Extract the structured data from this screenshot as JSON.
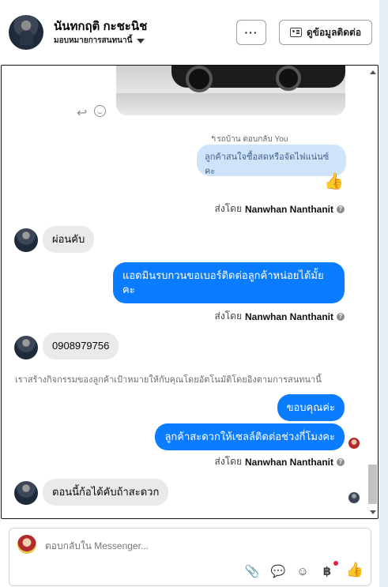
{
  "header": {
    "contact_name": "นันทกฤติ กะชะนิช",
    "assign_label": "มอบหมายการสนทนานี้",
    "more_label": "···",
    "contact_info_label": "ดูข้อมูลติดต่อ"
  },
  "thread": {
    "reply_label": "↰รถบ้าน ตอบกลับ You",
    "quoted_message": "ลูกค้าสนใจซื้อสดหรือจัดไฟแน่นซ์คะ",
    "sent_by_prefix": "ส่งโดย",
    "sender_name": "Nanwhan Nanthanit",
    "help_glyph": "?",
    "messages": [
      {
        "direction": "in",
        "text": "ผ่อนคับ"
      },
      {
        "direction": "out",
        "text_line1": "แอดมินรบกวนขอเบอร์ติดต่อลูกค้าหน่อยได้มั้ย",
        "text_line2": "คะ"
      },
      {
        "direction": "in",
        "text": "0908979756"
      },
      {
        "direction": "out",
        "text": "ขอบคุณค่ะ"
      },
      {
        "direction": "out",
        "text": "ลูกค้าสะดวกให้เซลล์ติดต่อช่วงกี่โมงคะ"
      },
      {
        "direction": "in",
        "text": "ตอนนี้ก้อได้คับถ้าสะดวก"
      }
    ],
    "info_line": "เราสร้างกิจกรรมของลูกค้าเป้าหมายให้กับคุณโดยอัตโนมัติโดยอิงตามการสนทนานี้"
  },
  "composer": {
    "placeholder": "ตอบกลับใน Messenger..."
  },
  "icons": {
    "reply": "reply-icon",
    "reaction": "smile-icon",
    "like": "thumbs-up-icon",
    "attach": "paperclip-icon",
    "saved_replies": "chat-bubble-icon",
    "emoji": "emoji-icon",
    "payment": "baht-icon"
  },
  "colors": {
    "outgoing_bubble": "#0a7cff",
    "incoming_bubble": "#eaeaea",
    "quoted_bubble": "#cfe4fb"
  }
}
